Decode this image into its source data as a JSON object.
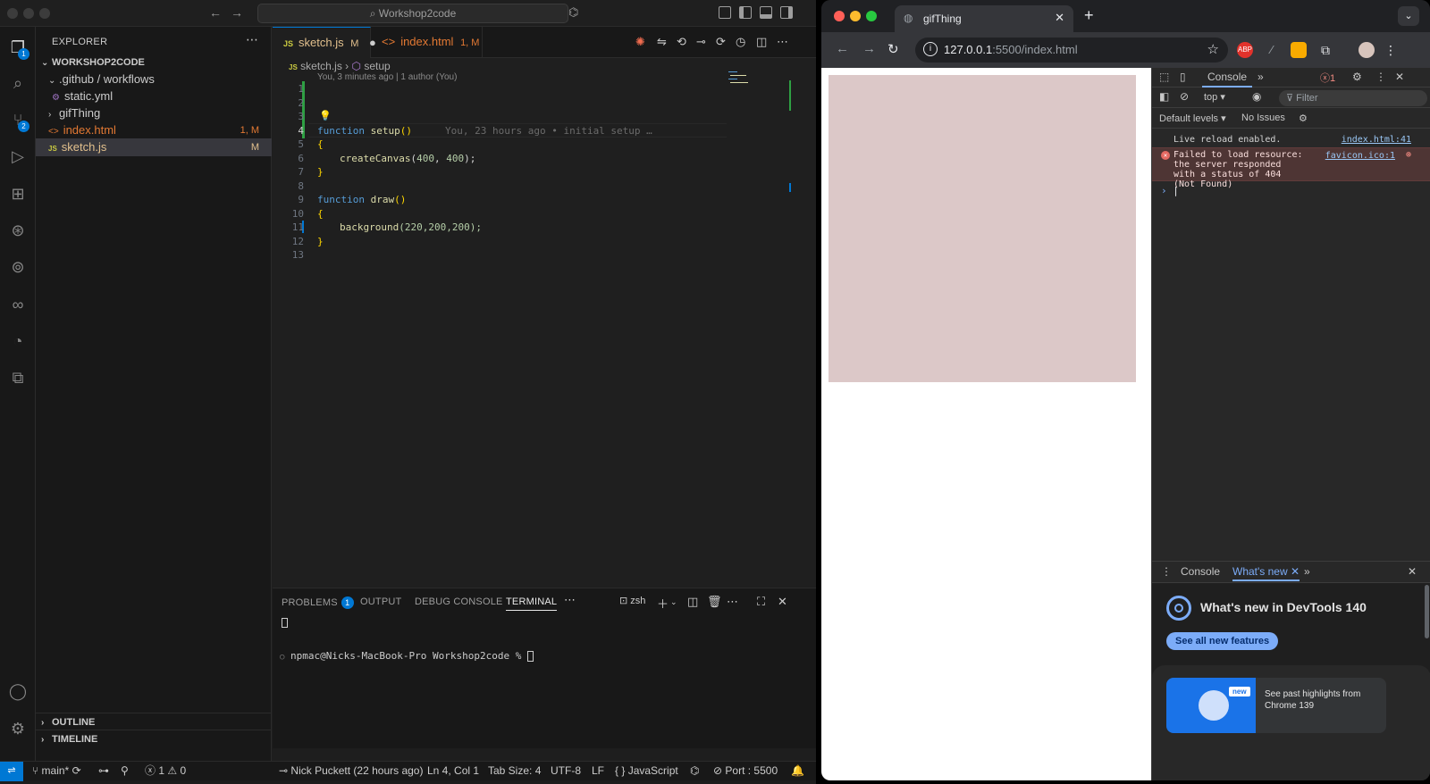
{
  "vscode": {
    "search": "Workshop2code",
    "activity_badges": {
      "explorer": "1",
      "scm": "2"
    },
    "explorer": {
      "title": "EXPLORER",
      "root": "WORKSHOP2CODE",
      "items": [
        {
          "label": ".github / workflows",
          "deco": ""
        },
        {
          "label": "static.yml",
          "deco": ""
        },
        {
          "label": "gifThing",
          "deco": ""
        },
        {
          "label": "index.html",
          "deco": "1, M"
        },
        {
          "label": "sketch.js",
          "deco": "M"
        }
      ],
      "outline": "OUTLINE",
      "timeline": "TIMELINE"
    },
    "tabs": [
      {
        "icon": "JS",
        "label": "sketch.js",
        "status": "M"
      },
      {
        "icon": "<>",
        "label": "index.html",
        "status": "1, M"
      }
    ],
    "breadcrumb": {
      "file": "sketch.js",
      "symbol": "setup"
    },
    "blame": "You, 3 minutes ago | 1 author (You)",
    "inline_blame": "You, 23 hours ago • initial setup …",
    "line_numbers": [
      "1",
      "2",
      "3",
      "4",
      "5",
      "6",
      "7",
      "8",
      "9",
      "10",
      "11",
      "12",
      "13"
    ],
    "code": {
      "l4_kw": "function",
      "l4_fn": "setup",
      "l4_rest": "()",
      "l5": "{",
      "l6_fn": "createCanvas",
      "l6_a": "(",
      "l6_n1": "400",
      "l6_c": ", ",
      "l6_n2": "400",
      "l6_e": ");",
      "l7": "}",
      "l9_kw": "function",
      "l9_fn": "draw",
      "l9_rest": "()",
      "l10": "{",
      "l11_fn": "background",
      "l11_rest": "(220,200,200);",
      "l12": "}"
    },
    "panel": {
      "tabs": [
        "PROBLEMS",
        "OUTPUT",
        "DEBUG CONSOLE",
        "TERMINAL"
      ],
      "problems_count": "1",
      "shell": "zsh",
      "terminal_prompt": "npmac@Nicks-MacBook-Pro Workshop2code %"
    },
    "status": {
      "branch": "main*",
      "errors": "1",
      "warnings": "0",
      "blame": "Nick Puckett (22 hours ago)",
      "position": "Ln 4, Col 1",
      "tab_size": "Tab Size: 4",
      "encoding": "UTF-8",
      "eol": "LF",
      "language": "JavaScript",
      "port": "Port : 5500"
    }
  },
  "chrome": {
    "tab_title": "gifThing",
    "url_host": "127.0.0.1",
    "url_path": ":5500/index.html",
    "extensions": [
      "ABP"
    ],
    "canvas_color": "#dcc8c8",
    "devtools": {
      "tab_console": "Console",
      "error_count": "1",
      "context": "top",
      "filter_placeholder": "Filter",
      "levels": "Default levels",
      "issues": "No Issues",
      "messages": [
        {
          "text": "Live reload enabled.",
          "source": "index.html:41"
        },
        {
          "text": "Failed to load resource: the server responded with a status of 404 (Not Found)",
          "source": "favicon.ico:1"
        }
      ],
      "drawer": {
        "tabs": [
          "Console",
          "What's new"
        ],
        "title": "What's new in DevTools 140",
        "button": "See all new features",
        "card_badge": "new",
        "card_text": "See past highlights from Chrome 139"
      }
    }
  }
}
